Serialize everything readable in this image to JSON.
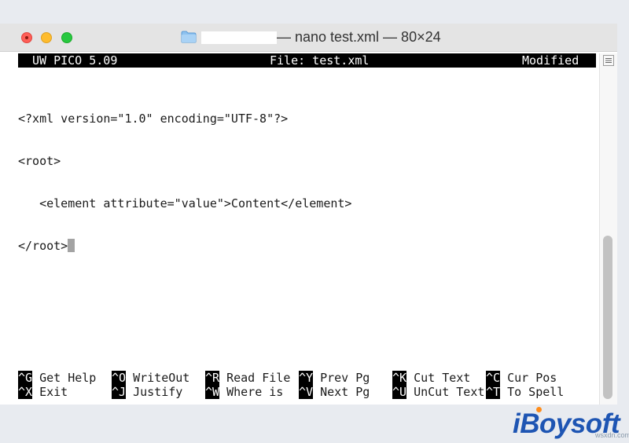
{
  "window": {
    "title": "— nano test.xml — 80×24"
  },
  "nano": {
    "header": {
      "app": "UW PICO 5.09",
      "file": "File: test.xml",
      "status": "Modified"
    },
    "lines": [
      "<?xml version=\"1.0\" encoding=\"UTF-8\"?>",
      "<root>",
      "   <element attribute=\"value\">Content</element>",
      "</root>"
    ],
    "shortcuts": {
      "row1": [
        {
          "key": "^G",
          "label": " Get Help"
        },
        {
          "key": "^O",
          "label": " WriteOut"
        },
        {
          "key": "^R",
          "label": " Read File"
        },
        {
          "key": "^Y",
          "label": " Prev Pg"
        },
        {
          "key": "^K",
          "label": " Cut Text"
        },
        {
          "key": "^C",
          "label": " Cur Pos"
        }
      ],
      "row2": [
        {
          "key": "^X",
          "label": " Exit"
        },
        {
          "key": "^J",
          "label": " Justify"
        },
        {
          "key": "^W",
          "label": " Where is"
        },
        {
          "key": "^V",
          "label": " Next Pg"
        },
        {
          "key": "^U",
          "label": " UnCut Text"
        },
        {
          "key": "^T",
          "label": " To Spell"
        }
      ]
    }
  },
  "brand": {
    "name": "iBoysoft",
    "watermark": "wsxdn.com"
  },
  "icons": [
    "close-icon",
    "minimize-icon",
    "zoom-icon",
    "folder-icon",
    "scroll-menu-icon"
  ],
  "colors": {
    "close": "#fe5f57",
    "minimize": "#febc2e",
    "zoom": "#28c840",
    "folder": "#7fb8e8",
    "brand": "#1e55b3"
  }
}
